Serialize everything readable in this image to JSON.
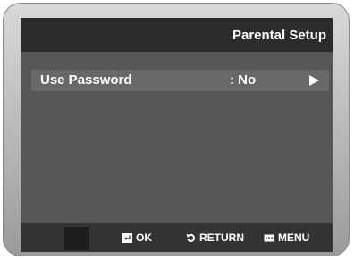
{
  "screen": {
    "title": "Parental Setup"
  },
  "menu": {
    "items": [
      {
        "label": "Use Password",
        "value": ": No",
        "icon": "right-arrow-icon"
      }
    ]
  },
  "footer": {
    "ok_label": "OK",
    "return_label": "RETURN",
    "menu_label": "MENU",
    "ok_icon": "enter-icon",
    "return_icon": "return-icon",
    "menu_icon": "menu-icon"
  },
  "colors": {
    "screen_bg": "#565656",
    "title_bar": "#2b2b2b",
    "highlight_row": "#686868",
    "footer_bg": "#333333",
    "text": "#ffffff"
  }
}
